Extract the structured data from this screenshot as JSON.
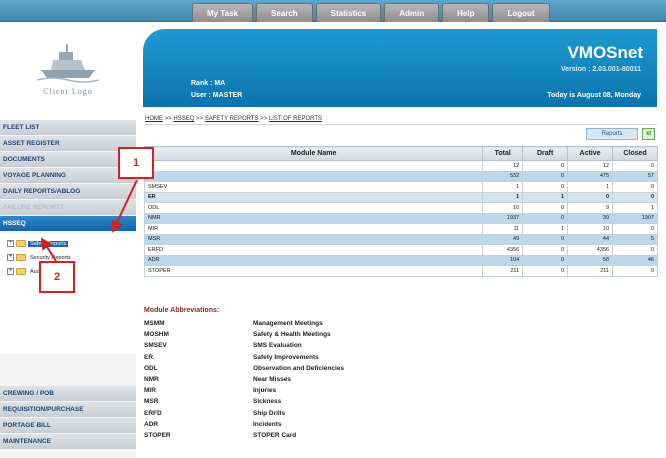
{
  "nav": {
    "tabs": [
      "My Task",
      "Search",
      "Statistics",
      "Admin",
      "Help",
      "Logout"
    ]
  },
  "logo": {
    "text": "Client Logo"
  },
  "header": {
    "brand": "VMOSnet",
    "version": "Version : 2.03.001-80011",
    "rank": "Rank : MA",
    "user": "User : MASTER",
    "today": "Today is August 08, Monday"
  },
  "sidebar": {
    "items": [
      "FLEET LIST",
      "ASSET REGISTER",
      "DOCUMENTS",
      "VOYAGE PLANNING",
      "DAILY REPORTS/ABLOG",
      "FAILURE REPORTS",
      "HSSEQ"
    ],
    "bottom_items": [
      "CREWING / POB",
      "REQUISITION/PURCHASE",
      "PORTAGE BILL",
      "MAINTENANCE"
    ],
    "tree": [
      "Safety Reports",
      "Security Reports",
      "Audit Reports"
    ]
  },
  "breadcrumb": {
    "home": "HOME",
    "sep": ">>",
    "hsseq": "HSSEQ",
    "safety": "SAFETY REPORTS",
    "list": "LIST OF REPORTS"
  },
  "toolbar": {
    "reports_label": "Reports",
    "excel_icon": "xl"
  },
  "table": {
    "headers": [
      "Module Name",
      "Total",
      "Draft",
      "Active",
      "Closed"
    ],
    "rows": [
      {
        "name": "",
        "total": "12",
        "draft": "0",
        "active": "12",
        "closed": "0"
      },
      {
        "name": "M",
        "total": "532",
        "draft": "0",
        "active": "475",
        "closed": "57"
      },
      {
        "name": "SMSEV",
        "total": "1",
        "draft": "0",
        "active": "1",
        "closed": "0"
      },
      {
        "name": "ER",
        "total": "1",
        "draft": "1",
        "active": "0",
        "closed": "0"
      },
      {
        "name": "ODL",
        "total": "10",
        "draft": "0",
        "active": "9",
        "closed": "1"
      },
      {
        "name": "NMR",
        "total": "1937",
        "draft": "0",
        "active": "30",
        "closed": "1907"
      },
      {
        "name": "MIR",
        "total": "11",
        "draft": "1",
        "active": "10",
        "closed": "0"
      },
      {
        "name": "MSR",
        "total": "49",
        "draft": "0",
        "active": "44",
        "closed": "5"
      },
      {
        "name": "ERFD",
        "total": "4356",
        "draft": "0",
        "active": "4356",
        "closed": "0"
      },
      {
        "name": "ADR",
        "total": "104",
        "draft": "0",
        "active": "58",
        "closed": "46"
      },
      {
        "name": "STOPER",
        "total": "211",
        "draft": "0",
        "active": "211",
        "closed": "0"
      }
    ]
  },
  "abbreviations": {
    "title": "Module Abbreviations:",
    "items": [
      {
        "code": "MSMM",
        "desc": "Management Meetings"
      },
      {
        "code": "MOSHM",
        "desc": "Safety & Health Meetings"
      },
      {
        "code": "SMSEV",
        "desc": "SMS Evaluation"
      },
      {
        "code": "ER",
        "desc": "Safety Improvements"
      },
      {
        "code": "ODL",
        "desc": "Observation and Deficiencies"
      },
      {
        "code": "NMR",
        "desc": "Near Misses"
      },
      {
        "code": "MIR",
        "desc": "Injuries"
      },
      {
        "code": "MSR",
        "desc": "Sickness"
      },
      {
        "code": "ERFD",
        "desc": "Ship Drills"
      },
      {
        "code": "ADR",
        "desc": "Incidents"
      },
      {
        "code": "STOPER",
        "desc": "STOPER Card"
      }
    ]
  },
  "annotations": {
    "one": "1",
    "two": "2",
    "color": "#d62020"
  },
  "colors": {
    "banner": "#1e9ad0",
    "topband": "#4f97bd",
    "active_menu": "#1566a8",
    "row_alt": "#bcd6ea"
  }
}
